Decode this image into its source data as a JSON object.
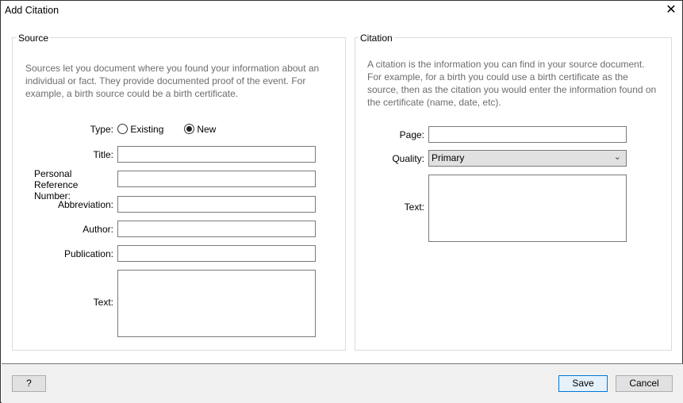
{
  "window": {
    "title": "Add Citation",
    "close_icon": "close-icon"
  },
  "source": {
    "legend": "Source",
    "description": "Sources let you document where you found your information about an individual or fact. They provide documented proof of the event. For example, a birth source could be a birth certificate.",
    "type_label": "Type:",
    "type_options": [
      {
        "label": "Existing",
        "selected": false
      },
      {
        "label": "New",
        "selected": true
      }
    ],
    "title_label": "Title:",
    "title_value": "",
    "prn_label": "Personal Reference Number:",
    "prn_value": "",
    "abbreviation_label": "Abbreviation:",
    "abbreviation_value": "",
    "author_label": "Author:",
    "author_value": "",
    "publication_label": "Publication:",
    "publication_value": "",
    "text_label": "Text:",
    "text_value": ""
  },
  "citation": {
    "legend": "Citation",
    "description": "A citation is the information you can find in your source document. For example, for a birth you could use a birth certificate as the source, then as the citation you would enter the information found on the certificate (name, date, etc).",
    "page_label": "Page:",
    "page_value": "",
    "quality_label": "Quality:",
    "quality_value": "Primary",
    "text_label": "Text:",
    "text_value": ""
  },
  "footer": {
    "help_label": "?",
    "save_label": "Save",
    "cancel_label": "Cancel"
  }
}
